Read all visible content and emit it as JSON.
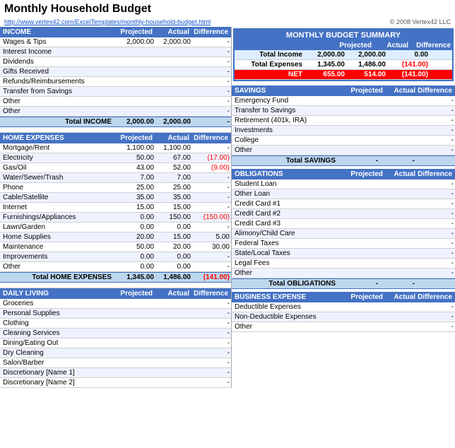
{
  "title": "Monthly Household Budget",
  "link": "http://www.vertex42.com/ExcelTemplates/monthly-household-budget.html",
  "copyright": "© 2008 Vertex42 LLC",
  "summary": {
    "header": "MONTHLY BUDGET SUMMARY",
    "cols": [
      "",
      "Projected",
      "Actual",
      "Difference"
    ],
    "rows": [
      {
        "label": "Total Income",
        "projected": "2,000.00",
        "actual": "2,000.00",
        "diff": "0.00",
        "diffNeg": false
      },
      {
        "label": "Total Expenses",
        "projected": "1,345.00",
        "actual": "1,486.00",
        "diff": "(141.00)",
        "diffNeg": true
      },
      {
        "label": "NET",
        "projected": "655.00",
        "actual": "514.00",
        "diff": "(141.00)",
        "diffNeg": true,
        "isNet": true
      }
    ]
  },
  "income": {
    "header": "INCOME",
    "rows": [
      {
        "label": "Wages & Tips",
        "projected": "2,000.00",
        "actual": "2,000.00",
        "diff": "-"
      },
      {
        "label": "Interest Income",
        "projected": "",
        "actual": "",
        "diff": "-"
      },
      {
        "label": "Dividends",
        "projected": "",
        "actual": "",
        "diff": "-"
      },
      {
        "label": "Gifts Received",
        "projected": "",
        "actual": "",
        "diff": "-"
      },
      {
        "label": "Refunds/Reimbursements",
        "projected": "",
        "actual": "",
        "diff": "-"
      },
      {
        "label": "Transfer from Savings",
        "projected": "",
        "actual": "",
        "diff": "-"
      },
      {
        "label": "Other",
        "projected": "",
        "actual": "",
        "diff": "-"
      },
      {
        "label": "Other",
        "projected": "",
        "actual": "",
        "diff": "-"
      }
    ],
    "total": {
      "label": "Total INCOME",
      "projected": "2,000.00",
      "actual": "2,000.00",
      "diff": "-"
    }
  },
  "homeExpenses": {
    "header": "HOME EXPENSES",
    "rows": [
      {
        "label": "Mortgage/Rent",
        "projected": "1,100.00",
        "actual": "1,100.00",
        "diff": "-"
      },
      {
        "label": "Electricity",
        "projected": "50.00",
        "actual": "67.00",
        "diff": "(17.00)",
        "diffNeg": true
      },
      {
        "label": "Gas/Oil",
        "projected": "43.00",
        "actual": "52.00",
        "diff": "(9.00)",
        "diffNeg": true
      },
      {
        "label": "Water/Sewer/Trash",
        "projected": "7.00",
        "actual": "7.00",
        "diff": "-"
      },
      {
        "label": "Phone",
        "projected": "25.00",
        "actual": "25.00",
        "diff": "-"
      },
      {
        "label": "Cable/Satellite",
        "projected": "35.00",
        "actual": "35.00",
        "diff": "-"
      },
      {
        "label": "Internet",
        "projected": "15.00",
        "actual": "15.00",
        "diff": "-"
      },
      {
        "label": "Furnishings/Appliances",
        "projected": "0.00",
        "actual": "150.00",
        "diff": "(150.00)",
        "diffNeg": true
      },
      {
        "label": "Lawn/Garden",
        "projected": "0.00",
        "actual": "0.00",
        "diff": "-"
      },
      {
        "label": "Home Supplies",
        "projected": "20.00",
        "actual": "15.00",
        "diff": "5.00"
      },
      {
        "label": "Maintenance",
        "projected": "50.00",
        "actual": "20.00",
        "diff": "30.00"
      },
      {
        "label": "Improvements",
        "projected": "0.00",
        "actual": "0.00",
        "diff": "-"
      },
      {
        "label": "Other",
        "projected": "0.00",
        "actual": "0.00",
        "diff": "-"
      }
    ],
    "total": {
      "label": "Total HOME EXPENSES",
      "projected": "1,345.00",
      "actual": "1,486.00",
      "diff": "(141.00)",
      "diffNeg": true
    }
  },
  "dailyLiving": {
    "header": "DAILY LIVING",
    "rows": [
      {
        "label": "Groceries",
        "projected": "",
        "actual": "",
        "diff": "-"
      },
      {
        "label": "Personal Supplies",
        "projected": "",
        "actual": "",
        "diff": "-"
      },
      {
        "label": "Clothing",
        "projected": "",
        "actual": "",
        "diff": "-"
      },
      {
        "label": "Cleaning Services",
        "projected": "",
        "actual": "",
        "diff": "-"
      },
      {
        "label": "Dining/Eating Out",
        "projected": "",
        "actual": "",
        "diff": "-"
      },
      {
        "label": "Dry Cleaning",
        "projected": "",
        "actual": "",
        "diff": "-"
      },
      {
        "label": "Salon/Barber",
        "projected": "",
        "actual": "",
        "diff": "-"
      },
      {
        "label": "Discretionary [Name 1]",
        "projected": "",
        "actual": "",
        "diff": "-"
      },
      {
        "label": "Discretionary [Name 2]",
        "projected": "",
        "actual": "",
        "diff": "-"
      }
    ]
  },
  "savings": {
    "header": "SAVINGS",
    "rows": [
      {
        "label": "Emergency Fund",
        "projected": "",
        "actual": "",
        "diff": "-"
      },
      {
        "label": "Transfer to Savings",
        "projected": "",
        "actual": "",
        "diff": "-"
      },
      {
        "label": "Retirement (401k, IRA)",
        "projected": "",
        "actual": "",
        "diff": "-"
      },
      {
        "label": "Investments",
        "projected": "",
        "actual": "",
        "diff": "-"
      },
      {
        "label": "College",
        "projected": "",
        "actual": "",
        "diff": "-"
      },
      {
        "label": "Other",
        "projected": "",
        "actual": "",
        "diff": "-"
      }
    ],
    "total": {
      "label": "Total SAVINGS",
      "projected": "-",
      "actual": "-",
      "diff": ""
    }
  },
  "obligations": {
    "header": "OBLIGATIONS",
    "rows": [
      {
        "label": "Student Loan",
        "projected": "",
        "actual": "",
        "diff": "-"
      },
      {
        "label": "Other Loan",
        "projected": "",
        "actual": "",
        "diff": "-"
      },
      {
        "label": "Credit Card #1",
        "projected": "",
        "actual": "",
        "diff": "-"
      },
      {
        "label": "Credit Card #2",
        "projected": "",
        "actual": "",
        "diff": "-"
      },
      {
        "label": "Credit Card #3",
        "projected": "",
        "actual": "",
        "diff": "-"
      },
      {
        "label": "Alimony/Child Care",
        "projected": "",
        "actual": "",
        "diff": "-"
      },
      {
        "label": "Federal Taxes",
        "projected": "",
        "actual": "",
        "diff": "-"
      },
      {
        "label": "State/Local Taxes",
        "projected": "",
        "actual": "",
        "diff": "-"
      },
      {
        "label": "Legal Fees",
        "projected": "",
        "actual": "",
        "diff": "-"
      },
      {
        "label": "Other",
        "projected": "",
        "actual": "",
        "diff": "-"
      }
    ],
    "total": {
      "label": "Total OBLIGATIONS",
      "projected": "-",
      "actual": "-",
      "diff": ""
    }
  },
  "businessExpense": {
    "header": "BUSINESS EXPENSE",
    "rows": [
      {
        "label": "Deductible Expenses",
        "projected": "",
        "actual": "",
        "diff": "-"
      },
      {
        "label": "Non-Deductible Expenses",
        "projected": "",
        "actual": "",
        "diff": "-"
      },
      {
        "label": "Other",
        "projected": "",
        "actual": "",
        "diff": "-"
      }
    ]
  },
  "cols": {
    "projected": "Projected",
    "actual": "Actual",
    "difference": "Difference"
  }
}
